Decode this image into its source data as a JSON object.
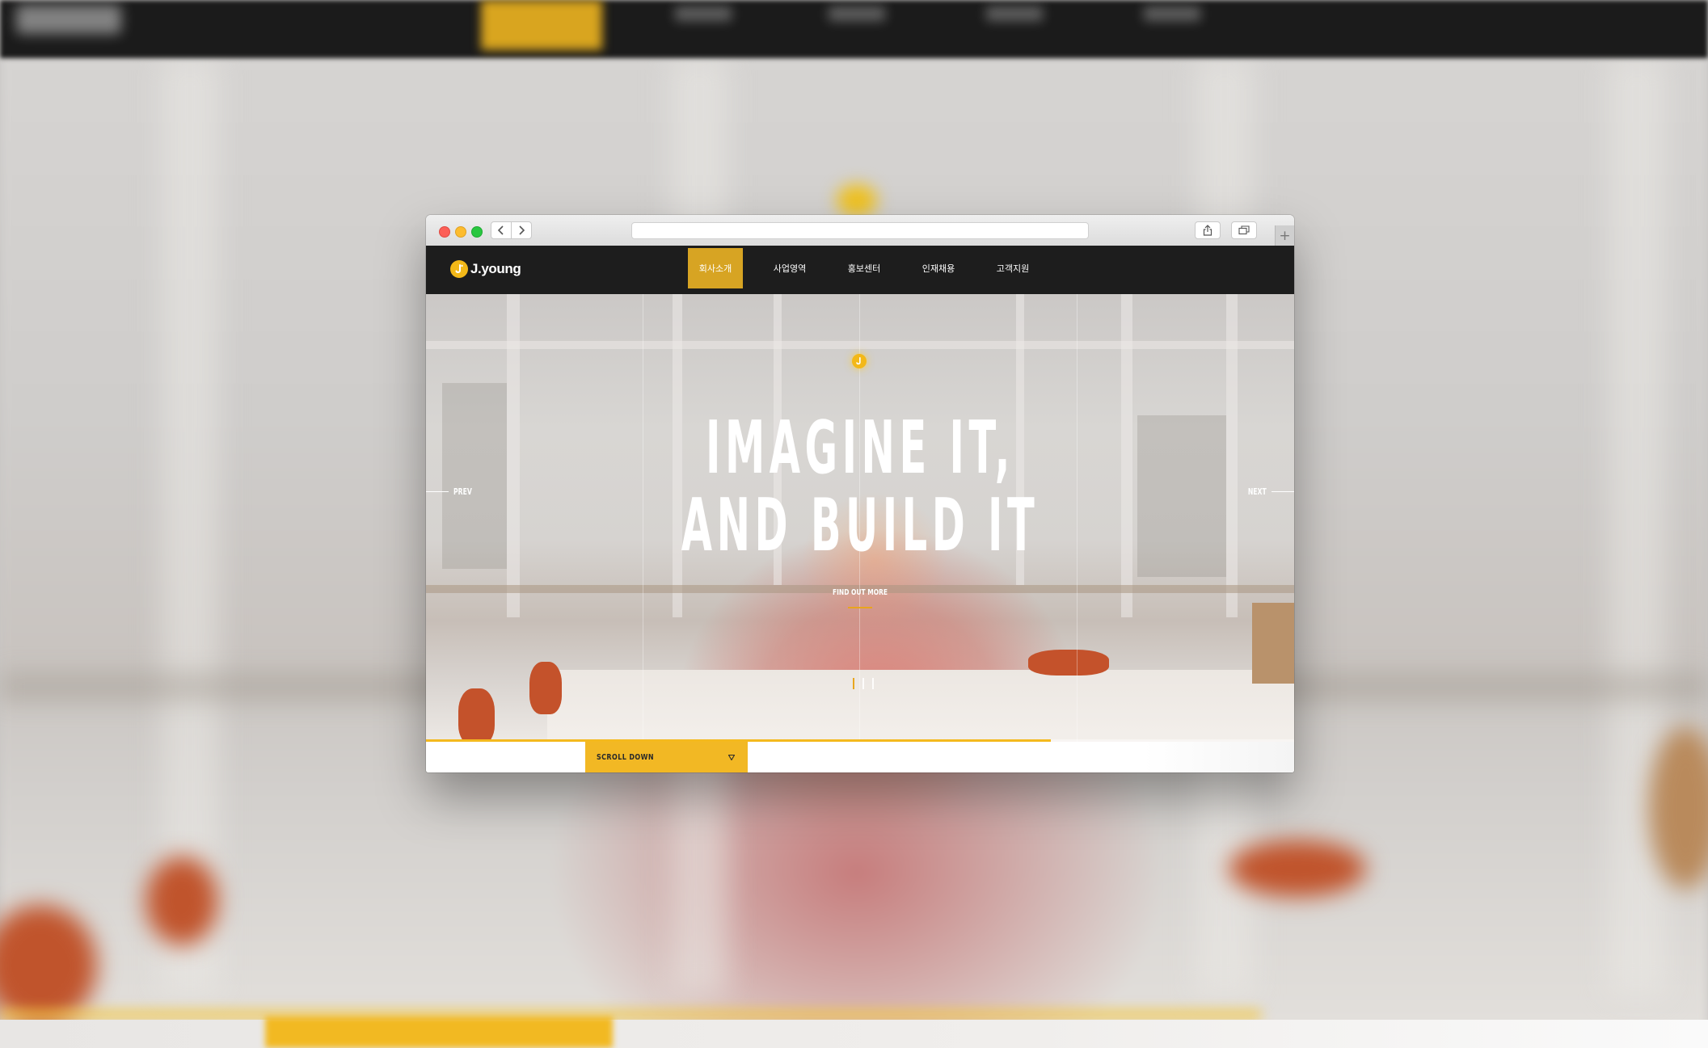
{
  "browser": {
    "url": "",
    "back_icon": "chevron-left-icon",
    "forward_icon": "chevron-right-icon",
    "share_icon": "share-icon",
    "tabs_icon": "tabs-overview-icon",
    "new_tab_icon": "plus-icon"
  },
  "site": {
    "logo_text": "J.young",
    "logo_icon": "j-logo-icon",
    "nav": [
      {
        "label": "회사소개",
        "active": true
      },
      {
        "label": "사업영역",
        "active": false
      },
      {
        "label": "홍보센터",
        "active": false
      },
      {
        "label": "인재채용",
        "active": false
      },
      {
        "label": "고객지원",
        "active": false
      }
    ]
  },
  "hero": {
    "headline_line1": "IMAGINE IT,",
    "headline_line2": "AND BUILD IT",
    "cta": "FIND OUT MORE",
    "prev": "PREV",
    "next": "NEXT",
    "slide_count": 3,
    "active_slide": 1,
    "progress": 0.72
  },
  "footer_bar": {
    "scroll_label": "SCROLL DOWN",
    "scroll_icon": "triangle-down-icon"
  },
  "colors": {
    "accent": "#f2b824",
    "nav_active": "#d7a423",
    "nav_bg": "#1d1d1d"
  }
}
